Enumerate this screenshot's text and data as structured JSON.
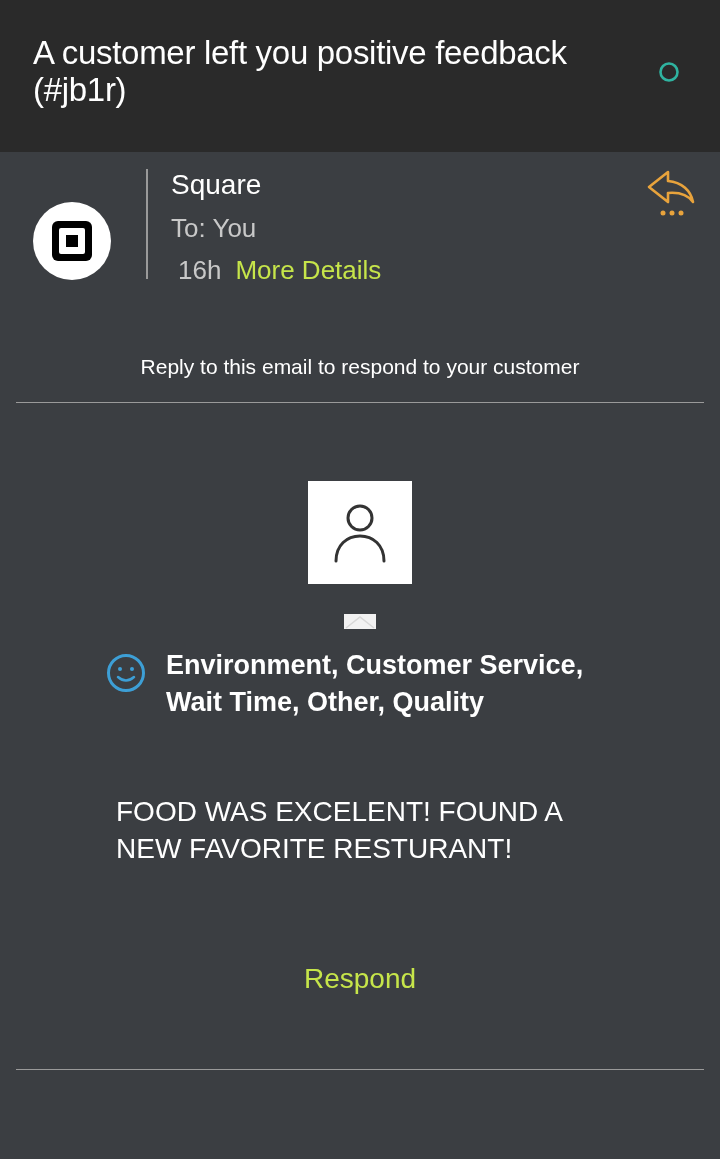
{
  "header": {
    "subject": "A customer left you positive feedback (#jb1r)"
  },
  "sender": {
    "name": "Square",
    "recipient": "To: You",
    "time": "16h",
    "details_link": "More Details"
  },
  "notice": "Reply to this email to respond to your customer",
  "feedback": {
    "categories": "Environment, Customer Service, Wait Time, Other, Quality",
    "comment": "FOOD WAS EXCELENT! FOUND A NEW FAVORITE RESTURANT!",
    "action": "Respond"
  }
}
